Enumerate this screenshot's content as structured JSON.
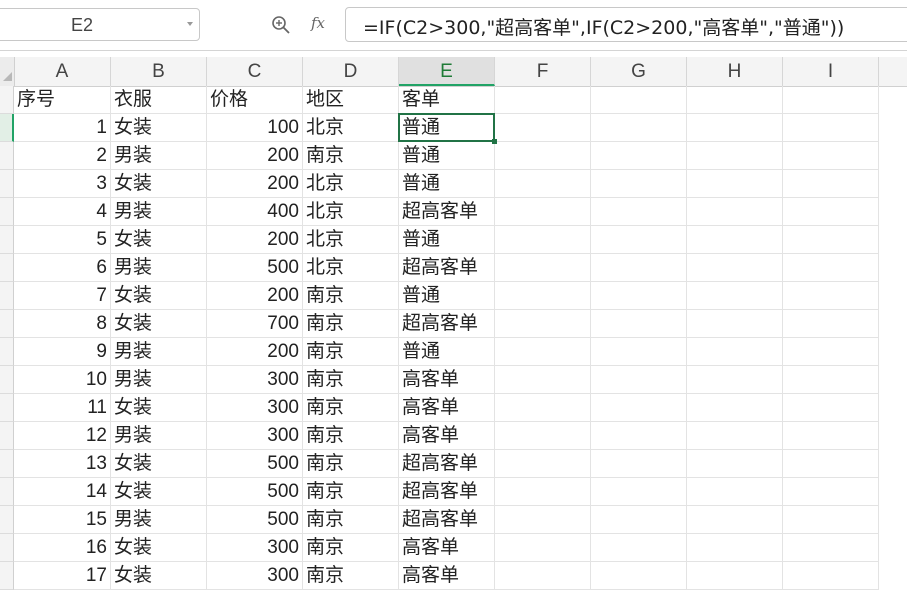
{
  "formula_bar": {
    "name_box": "E2",
    "fx_label": "fx",
    "formula": "=IF(C2>300,\"超高客单\",IF(C2>200,\"高客单\",\"普通\"))"
  },
  "columns": [
    "A",
    "B",
    "C",
    "D",
    "E",
    "F",
    "G",
    "H",
    "I"
  ],
  "selected_column": "E",
  "header_row": [
    "序号",
    "衣服",
    "价格",
    "地区",
    "客单"
  ],
  "rows": [
    [
      "1",
      "女装",
      "100",
      "北京",
      "普通"
    ],
    [
      "2",
      "男装",
      "200",
      "南京",
      "普通"
    ],
    [
      "3",
      "女装",
      "200",
      "北京",
      "普通"
    ],
    [
      "4",
      "男装",
      "400",
      "北京",
      "超高客单"
    ],
    [
      "5",
      "女装",
      "200",
      "北京",
      "普通"
    ],
    [
      "6",
      "男装",
      "500",
      "北京",
      "超高客单"
    ],
    [
      "7",
      "女装",
      "200",
      "南京",
      "普通"
    ],
    [
      "8",
      "女装",
      "700",
      "南京",
      "超高客单"
    ],
    [
      "9",
      "男装",
      "200",
      "南京",
      "普通"
    ],
    [
      "10",
      "男装",
      "300",
      "南京",
      "高客单"
    ],
    [
      "11",
      "女装",
      "300",
      "南京",
      "高客单"
    ],
    [
      "12",
      "男装",
      "300",
      "南京",
      "高客单"
    ],
    [
      "13",
      "女装",
      "500",
      "南京",
      "超高客单"
    ],
    [
      "14",
      "女装",
      "500",
      "南京",
      "超高客单"
    ],
    [
      "15",
      "男装",
      "500",
      "南京",
      "超高客单"
    ],
    [
      "16",
      "女装",
      "300",
      "南京",
      "高客单"
    ],
    [
      "17",
      "女装",
      "300",
      "南京",
      "高客单"
    ]
  ],
  "colors": {
    "accent": "#217346",
    "selected_header_text": "#1e7a36"
  }
}
